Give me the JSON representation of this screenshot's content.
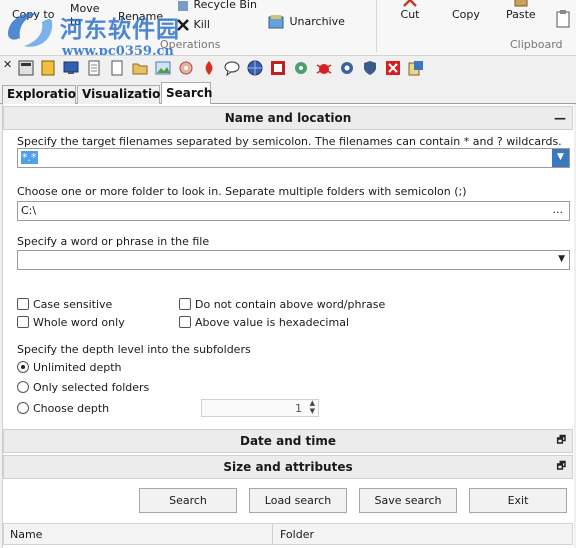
{
  "ribbon": {
    "copy_to": "Copy to",
    "move_to": "Move to",
    "rename": "Rename...",
    "recycle_bin": "Recycle Bin",
    "kill": "Kill",
    "unarchive": "Unarchive",
    "operations_group": "Operations",
    "cut": "Cut",
    "copy": "Copy",
    "paste": "Paste",
    "clipboard_group": "Clipboard"
  },
  "watermark": {
    "site_name": "河东软件园",
    "url": "www.pc0359.cn"
  },
  "toolbar": {
    "close_glyph": "✕"
  },
  "tabs": [
    {
      "label": "Exploration",
      "active": false
    },
    {
      "label": "Visualization",
      "active": false
    },
    {
      "label": "Search",
      "active": true
    }
  ],
  "name_location": {
    "header": "Name and location",
    "collapse_glyph": "—",
    "filenames_label": "Specify the target filenames separated by semicolon. The filenames can contain * and ? wildcards.",
    "filenames_value": "*.*",
    "folders_label": "Choose one or more folder to look in. Separate multiple folders with semicolon (;)",
    "folders_value": "C:\\",
    "folders_browse": "...",
    "phrase_label": "Specify a word or phrase in the file",
    "phrase_value": "",
    "options": {
      "case_sensitive": "Case sensitive",
      "whole_word": "Whole word only",
      "not_contain": "Do not contain above word/phrase",
      "hexadecimal": "Above value is hexadecimal"
    },
    "depth_label": "Specify the depth level into the subfolders",
    "depth_options": {
      "unlimited": "Unlimited depth",
      "selected_only": "Only selected folders",
      "choose": "Choose depth"
    },
    "depth_value": "1"
  },
  "date_time": {
    "header": "Date and time",
    "expand_glyph": "🗗"
  },
  "size_attributes": {
    "header": "Size and attributes",
    "expand_glyph": "🗗"
  },
  "buttons": {
    "search": "Search",
    "load_search": "Load search",
    "save_search": "Save search",
    "exit": "Exit"
  },
  "results": {
    "col_name": "Name",
    "col_folder": "Folder"
  },
  "colors": {
    "selection": "#4fa0e8",
    "dropdown_button": "#3a78c0",
    "watermark": "#286ec8"
  }
}
